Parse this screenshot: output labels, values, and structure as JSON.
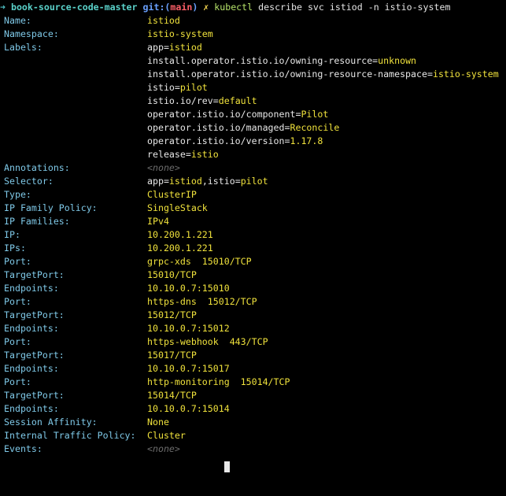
{
  "prompt": {
    "arrow": "➜",
    "directory": "book-source-code-master",
    "git_label": "git:(",
    "branch": "main",
    "git_close": ")",
    "dirty_mark": "✗",
    "command": "kubectl",
    "arguments": "describe svc istiod -n istio-system"
  },
  "fields": [
    {
      "key": "Name:",
      "parts": [
        {
          "t": "istiod",
          "c": "v"
        }
      ]
    },
    {
      "key": "Namespace:",
      "parts": [
        {
          "t": "istio-system",
          "c": "v"
        }
      ]
    },
    {
      "key": "Labels:",
      "parts": [
        {
          "t": "app=",
          "c": "k"
        },
        {
          "t": "istiod",
          "c": "v"
        }
      ]
    },
    {
      "key": "",
      "parts": [
        {
          "t": "install.operator.istio.io/owning-resource=",
          "c": "k"
        },
        {
          "t": "unknown",
          "c": "v"
        }
      ]
    },
    {
      "key": "",
      "parts": [
        {
          "t": "install.operator.istio.io/owning-resource-namespace=",
          "c": "k"
        },
        {
          "t": "istio-system",
          "c": "v"
        }
      ]
    },
    {
      "key": "",
      "parts": [
        {
          "t": "istio=",
          "c": "k"
        },
        {
          "t": "pilot",
          "c": "v"
        }
      ]
    },
    {
      "key": "",
      "parts": [
        {
          "t": "istio.io/rev=",
          "c": "k"
        },
        {
          "t": "default",
          "c": "v"
        }
      ]
    },
    {
      "key": "",
      "parts": [
        {
          "t": "operator.istio.io/component=",
          "c": "k"
        },
        {
          "t": "Pilot",
          "c": "v"
        }
      ]
    },
    {
      "key": "",
      "parts": [
        {
          "t": "operator.istio.io/managed=",
          "c": "k"
        },
        {
          "t": "Reconcile",
          "c": "v"
        }
      ]
    },
    {
      "key": "",
      "parts": [
        {
          "t": "operator.istio.io/version=",
          "c": "k"
        },
        {
          "t": "1.17.8",
          "c": "v"
        }
      ]
    },
    {
      "key": "",
      "parts": [
        {
          "t": "release=",
          "c": "k"
        },
        {
          "t": "istio",
          "c": "v"
        }
      ]
    },
    {
      "key": "Annotations:",
      "parts": [
        {
          "t": "<none>",
          "c": "none"
        }
      ]
    },
    {
      "key": "Selector:",
      "parts": [
        {
          "t": "app=",
          "c": "k"
        },
        {
          "t": "istiod",
          "c": "v"
        },
        {
          "t": ",",
          "c": "k"
        },
        {
          "t": "istio=",
          "c": "k"
        },
        {
          "t": "pilot",
          "c": "v"
        }
      ]
    },
    {
      "key": "Type:",
      "parts": [
        {
          "t": "ClusterIP",
          "c": "v"
        }
      ]
    },
    {
      "key": "IP Family Policy:",
      "parts": [
        {
          "t": "SingleStack",
          "c": "v"
        }
      ]
    },
    {
      "key": "IP Families:",
      "parts": [
        {
          "t": "IPv4",
          "c": "v"
        }
      ]
    },
    {
      "key": "IP:",
      "parts": [
        {
          "t": "10.200.1.221",
          "c": "v"
        }
      ]
    },
    {
      "key": "IPs:",
      "parts": [
        {
          "t": "10.200.1.221",
          "c": "v"
        }
      ]
    },
    {
      "key": "Port:",
      "parts": [
        {
          "t": "grpc-xds  15010/TCP",
          "c": "v"
        }
      ]
    },
    {
      "key": "TargetPort:",
      "parts": [
        {
          "t": "15010/TCP",
          "c": "v"
        }
      ]
    },
    {
      "key": "Endpoints:",
      "parts": [
        {
          "t": "10.10.0.7:15010",
          "c": "v"
        }
      ]
    },
    {
      "key": "Port:",
      "parts": [
        {
          "t": "https-dns  15012/TCP",
          "c": "v"
        }
      ]
    },
    {
      "key": "TargetPort:",
      "parts": [
        {
          "t": "15012/TCP",
          "c": "v"
        }
      ]
    },
    {
      "key": "Endpoints:",
      "parts": [
        {
          "t": "10.10.0.7:15012",
          "c": "v"
        }
      ]
    },
    {
      "key": "Port:",
      "parts": [
        {
          "t": "https-webhook  443/TCP",
          "c": "v"
        }
      ]
    },
    {
      "key": "TargetPort:",
      "parts": [
        {
          "t": "15017/TCP",
          "c": "v"
        }
      ]
    },
    {
      "key": "Endpoints:",
      "parts": [
        {
          "t": "10.10.0.7:15017",
          "c": "v"
        }
      ]
    },
    {
      "key": "Port:",
      "parts": [
        {
          "t": "http-monitoring  15014/TCP",
          "c": "v"
        }
      ]
    },
    {
      "key": "TargetPort:",
      "parts": [
        {
          "t": "15014/TCP",
          "c": "v"
        }
      ]
    },
    {
      "key": "Endpoints:",
      "parts": [
        {
          "t": "10.10.0.7:15014",
          "c": "v"
        }
      ]
    },
    {
      "key": "Session Affinity:",
      "parts": [
        {
          "t": "None",
          "c": "v"
        }
      ]
    },
    {
      "key": "Internal Traffic Policy:",
      "parts": [
        {
          "t": "Cluster",
          "c": "v"
        }
      ]
    },
    {
      "key": "Events:",
      "parts": [
        {
          "t": "<none>",
          "c": "none"
        }
      ]
    }
  ],
  "colors": {
    "background": "#000000",
    "key": "#7fc9e8",
    "value": "#f0e23c",
    "label_key": "#e8e8e8",
    "muted": "#6c6c6c"
  }
}
